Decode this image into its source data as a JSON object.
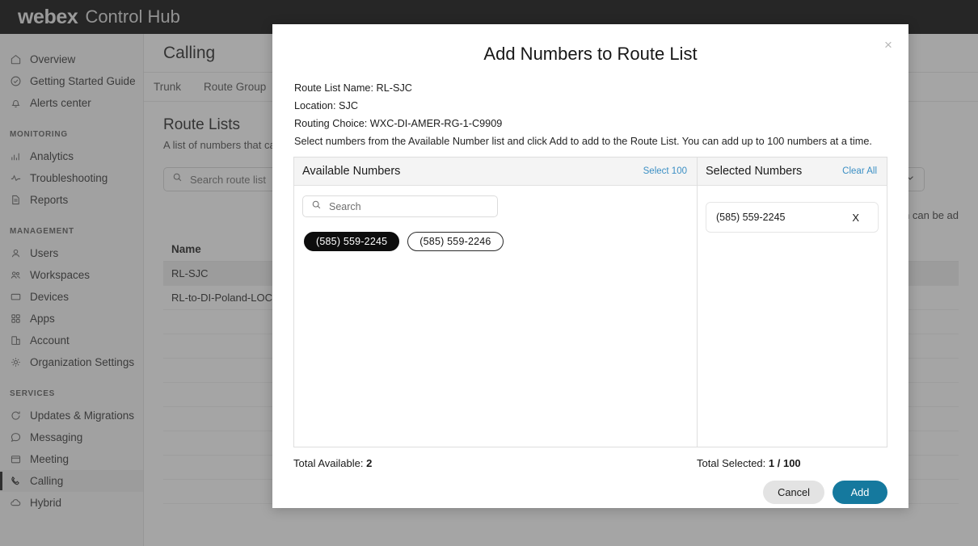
{
  "topbar": {
    "brand": "webex",
    "product": "Control Hub"
  },
  "sidebar": {
    "items": [
      {
        "label": "Overview",
        "icon": "home-icon",
        "name": "overview"
      },
      {
        "label": "Getting Started Guide",
        "icon": "check-circle-icon",
        "name": "getting-started-guide"
      },
      {
        "label": "Alerts center",
        "icon": "bell-icon",
        "name": "alerts-center"
      }
    ],
    "sections": [
      {
        "title": "MONITORING",
        "items": [
          {
            "label": "Analytics",
            "icon": "bar-chart-icon",
            "name": "analytics"
          },
          {
            "label": "Troubleshooting",
            "icon": "pulse-icon",
            "name": "troubleshooting"
          },
          {
            "label": "Reports",
            "icon": "document-icon",
            "name": "reports"
          }
        ]
      },
      {
        "title": "MANAGEMENT",
        "items": [
          {
            "label": "Users",
            "icon": "user-icon",
            "name": "users"
          },
          {
            "label": "Workspaces",
            "icon": "users-icon",
            "name": "workspaces"
          },
          {
            "label": "Devices",
            "icon": "device-icon",
            "name": "devices"
          },
          {
            "label": "Apps",
            "icon": "grid-icon",
            "name": "apps"
          },
          {
            "label": "Account",
            "icon": "building-icon",
            "name": "account"
          },
          {
            "label": "Organization Settings",
            "icon": "gear-icon",
            "name": "organization-settings"
          }
        ]
      },
      {
        "title": "SERVICES",
        "items": [
          {
            "label": "Updates & Migrations",
            "icon": "refresh-icon",
            "name": "updates-migrations"
          },
          {
            "label": "Messaging",
            "icon": "chat-icon",
            "name": "messaging"
          },
          {
            "label": "Meeting",
            "icon": "calendar-icon",
            "name": "meeting"
          },
          {
            "label": "Calling",
            "icon": "phone-icon",
            "name": "calling",
            "active": true
          },
          {
            "label": "Hybrid",
            "icon": "cloud-icon",
            "name": "hybrid"
          }
        ]
      }
    ]
  },
  "page": {
    "title": "Calling",
    "tabs": [
      {
        "label": "Trunk",
        "active": false
      },
      {
        "label": "Route Group",
        "active": false
      }
    ],
    "section_title": "Route Lists",
    "section_sub": "A list of numbers that can",
    "search_placeholder": "Search route list",
    "hint": "cation can be ad",
    "table": {
      "columns": [
        "Name"
      ],
      "rows": [
        {
          "name": "RL-SJC",
          "selected": true
        },
        {
          "name": "RL-to-DI-Poland-LOC",
          "selected": false
        }
      ]
    }
  },
  "modal": {
    "title": "Add Numbers to Route List",
    "close_label": "×",
    "meta": [
      "Route List Name: RL-SJC",
      "Location: SJC",
      "Routing Choice:  WXC-DI-AMER-RG-1-C9909"
    ],
    "description": "Select numbers from the Available Number list and click Add to add to the Route List. You can add up to 100 numbers at a time.",
    "available": {
      "heading": "Available Numbers",
      "action_label": "Select 100",
      "search_placeholder": "Search",
      "numbers": [
        {
          "value": "(585) 559-2245",
          "selected": true
        },
        {
          "value": "(585) 559-2246",
          "selected": false
        }
      ],
      "total_label": "Total Available:",
      "total_value": "2"
    },
    "selected": {
      "heading": "Selected Numbers",
      "action_label": "Clear All",
      "items": [
        {
          "value": "(585) 559-2245",
          "remove_label": "X"
        }
      ],
      "total_label": "Total Selected:",
      "total_value": "1 / 100"
    },
    "buttons": {
      "cancel": "Cancel",
      "add": "Add"
    },
    "colors": {
      "accent": "#15799e",
      "link": "#3b8fc4",
      "chip_selected_bg": "#0d0d0d"
    }
  }
}
